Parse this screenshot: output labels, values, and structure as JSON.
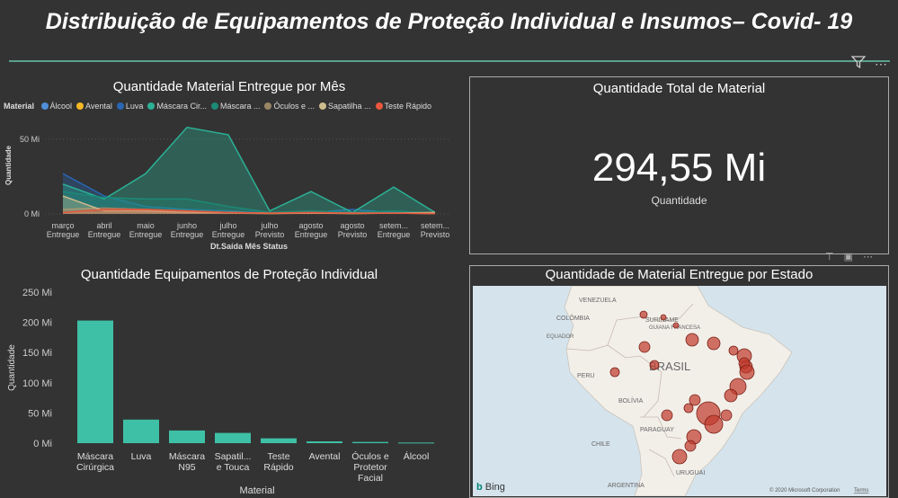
{
  "page": {
    "title": "Distribuição de Equipamentos de Proteção Individual e Insumos– Covid- 19"
  },
  "chart_data": [
    {
      "type": "area",
      "title": "Quantidade Material Entregue por Mês",
      "xlabel": "Dt.Saída Mês Status",
      "ylabel": "Quantidade",
      "legend_title": "Material",
      "legend_position": "top",
      "ylim": [
        0,
        65
      ],
      "y_ticks": [
        "0 Mi",
        "50 Mi"
      ],
      "categories": [
        [
          "março",
          "Entregue"
        ],
        [
          "abril",
          "Entregue"
        ],
        [
          "maio",
          "Entregue"
        ],
        [
          "junho",
          "Entregue"
        ],
        [
          "julho",
          "Entregue"
        ],
        [
          "julho",
          "Previsto"
        ],
        [
          "agosto",
          "Entregue"
        ],
        [
          "agosto",
          "Previsto"
        ],
        [
          "setem...",
          "Entregue"
        ],
        [
          "setem...",
          "Previsto"
        ]
      ],
      "series": [
        {
          "name": "Álcool",
          "color": "#4f8fd8",
          "values": [
            0.5,
            0.5,
            0.5,
            0.5,
            0.5,
            0.3,
            0.5,
            0.3,
            0.5,
            0.3
          ]
        },
        {
          "name": "Avental",
          "color": "#f5b925",
          "values": [
            1,
            1,
            1,
            1,
            0.5,
            0.3,
            0.5,
            0.3,
            0.5,
            0.3
          ]
        },
        {
          "name": "Luva",
          "color": "#2966b3",
          "values": [
            27,
            12,
            5,
            3,
            2,
            0.5,
            1,
            3,
            1,
            0.5
          ]
        },
        {
          "name": "Máscara Cir...",
          "color": "#2bb195",
          "values": [
            20,
            10,
            27,
            58,
            53,
            2,
            15,
            1,
            18,
            1
          ]
        },
        {
          "name": "Máscara ...",
          "color": "#1c8a77",
          "values": [
            15,
            11,
            10,
            10,
            5,
            1,
            2,
            1,
            2,
            0.5
          ]
        },
        {
          "name": "Óculos e ...",
          "color": "#9a8564",
          "values": [
            3,
            4,
            3,
            2,
            1,
            0.5,
            0.5,
            0.5,
            0.5,
            0.3
          ]
        },
        {
          "name": "Sapatilha ...",
          "color": "#cdbc8c",
          "values": [
            12,
            2,
            2,
            1,
            1,
            0.5,
            0.5,
            0.5,
            0.5,
            1
          ]
        },
        {
          "name": "Teste Rápido",
          "color": "#e8573d",
          "values": [
            1,
            3,
            3,
            2,
            1,
            0.5,
            1,
            0.5,
            0.5,
            0.3
          ]
        }
      ]
    },
    {
      "type": "bar",
      "title": "Quantidade Equipamentos de Proteção Individual",
      "xlabel": "Material",
      "ylabel": "Quantidade",
      "ylim": [
        0,
        250
      ],
      "y_ticks": [
        "0 Mi",
        "50 Mi",
        "100 Mi",
        "150 Mi",
        "200 Mi",
        "250 Mi"
      ],
      "color": "#3ec0a6",
      "categories": [
        [
          "Máscara",
          "Cirúrgica"
        ],
        [
          "Luva"
        ],
        [
          "Máscara",
          "N95"
        ],
        [
          "Sapatil...",
          "e Touca"
        ],
        [
          "Teste",
          "Rápido"
        ],
        [
          "Avental"
        ],
        [
          "Óculos e",
          "Protetor",
          "Facial"
        ],
        [
          "Álcool"
        ]
      ],
      "values": [
        203,
        39,
        21,
        17,
        8,
        3,
        2,
        1
      ]
    }
  ],
  "kpi": {
    "title": "Quantidade Total de Material",
    "value": "294,55 Mi",
    "label": "Quantidade"
  },
  "map": {
    "title": "Quantidade de Material Entregue por Estado",
    "country_labels": [
      "VENEZUELA",
      "COLÔMBIA",
      "SURINAME",
      "GUIANA FRANCESA",
      "EQUADOR",
      "PERU",
      "BRASIL",
      "BOLÍVIA",
      "PARAGUAY",
      "CHILE",
      "ARGENTINA",
      "URUGUAI"
    ],
    "bubble_color": "#c0392b",
    "attribution": "© 2020 Microsoft Corporation",
    "terms": "Terms",
    "provider": "Bing"
  }
}
